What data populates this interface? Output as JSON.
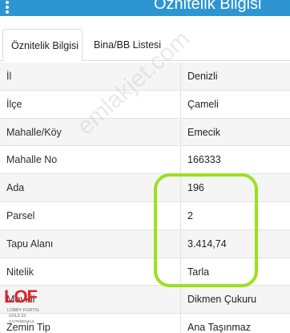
{
  "header": {
    "title": "Öznitelik Bilgisi",
    "menu_icon": "more-vertical-icon",
    "background": "#2e95d3"
  },
  "tabs": [
    {
      "label": "Öznitelik Bilgisi",
      "active": true
    },
    {
      "label": "Bina/BB Listesi",
      "active": false
    }
  ],
  "attributes": [
    {
      "key": "İl",
      "value": "Denizli"
    },
    {
      "key": "İlçe",
      "value": "Çameli"
    },
    {
      "key": "Mahalle/Köy",
      "value": "Emecik"
    },
    {
      "key": "Mahalle No",
      "value": "166333"
    },
    {
      "key": "Ada",
      "value": "196"
    },
    {
      "key": "Parsel",
      "value": "2"
    },
    {
      "key": "Tapu Alanı",
      "value": "3.414,74"
    },
    {
      "key": "Nitelik",
      "value": "Tarla"
    },
    {
      "key": "Mevkii",
      "value": "Dikmen Çukuru"
    },
    {
      "key": "Zemin Tip",
      "value": "Ana Taşınmaz"
    }
  ],
  "highlight_color": "#9be11d",
  "watermark": "emlakjet.com",
  "logo": {
    "mark": "LOF",
    "line1": "LOBBY FORTIS",
    "line2": "GOLD 33",
    "line3": "GAYRİMENKUL"
  }
}
